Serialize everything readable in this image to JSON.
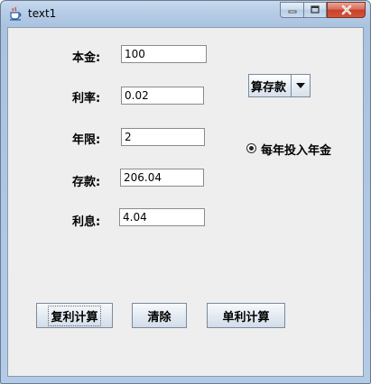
{
  "window": {
    "title": "text1",
    "icon": "java-cup-icon"
  },
  "form": {
    "principal": {
      "label": "本金:",
      "value": "100"
    },
    "rate": {
      "label": "利率:",
      "value": "0.02"
    },
    "years": {
      "label": "年限:",
      "value": "2"
    },
    "deposit": {
      "label": "存款:",
      "value": "206.04"
    },
    "interest": {
      "label": "利息:",
      "value": "4.04"
    }
  },
  "mode_select": {
    "selected": "算存款"
  },
  "radio_option": {
    "label": "每年投入年金",
    "checked": true
  },
  "buttons": {
    "compound": "复利计算",
    "clear": "清除",
    "simple": "单利计算"
  }
}
